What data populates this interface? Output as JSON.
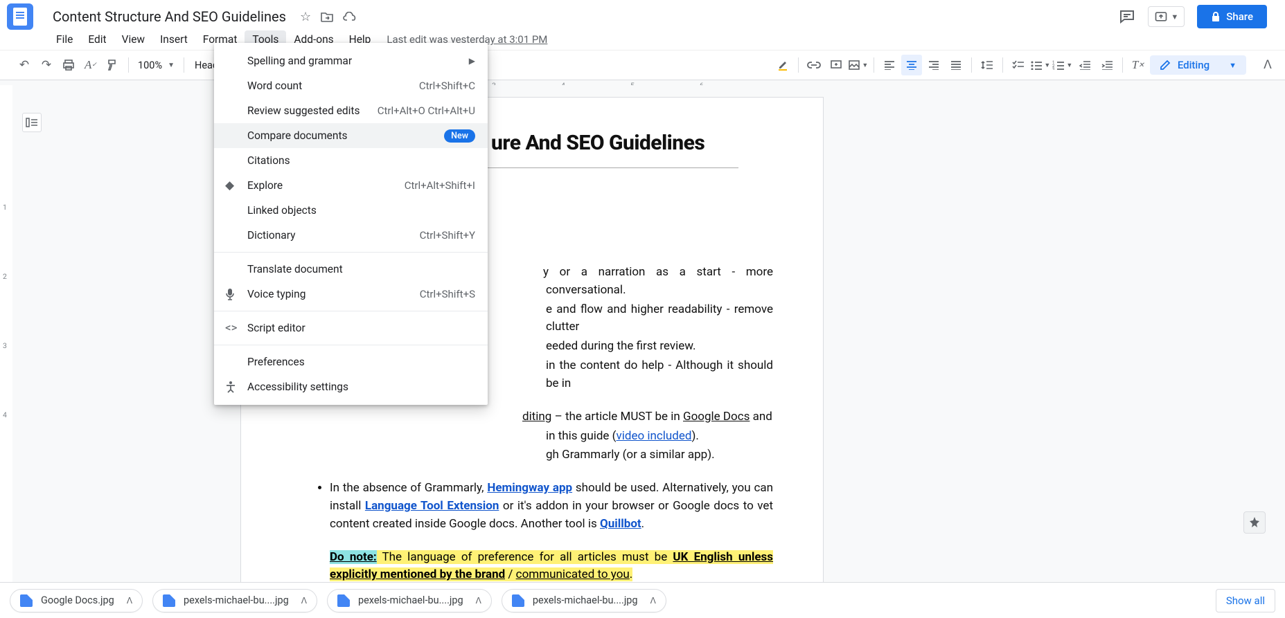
{
  "doc": {
    "title": "Content Structure And SEO Guidelines"
  },
  "menus": {
    "file": "File",
    "edit": "Edit",
    "view": "View",
    "insert": "Insert",
    "format": "Format",
    "tools": "Tools",
    "addons": "Add-ons",
    "help": "Help"
  },
  "last_edit": "Last edit was yesterday at 3:01 PM",
  "share": {
    "label": "Share"
  },
  "toolbar": {
    "zoom": "100%",
    "style": "Headin",
    "editing": "Editing"
  },
  "dropdown": {
    "spelling": "Spelling and grammar",
    "wordcount": {
      "label": "Word count",
      "shortcut": "Ctrl+Shift+C"
    },
    "review": {
      "label": "Review suggested edits",
      "shortcut": "Ctrl+Alt+O Ctrl+Alt+U"
    },
    "compare": {
      "label": "Compare documents",
      "badge": "New"
    },
    "citations": "Citations",
    "explore": {
      "label": "Explore",
      "shortcut": "Ctrl+Alt+Shift+I"
    },
    "linked": "Linked objects",
    "dictionary": {
      "label": "Dictionary",
      "shortcut": "Ctrl+Shift+Y"
    },
    "translate": "Translate document",
    "voice": {
      "label": "Voice typing",
      "shortcut": "Ctrl+Shift+S"
    },
    "script": "Script editor",
    "prefs": "Preferences",
    "a11y": "Accessibility settings"
  },
  "page_content": {
    "heading_partial": "ure And SEO Guidelines",
    "b1_a": "y or a narration as a start - more conversational.",
    "b2_a": "e and flow and higher readability - remove clutter",
    "b2_b": "eeded during the first review.",
    "b3_a": " in the content do help - Although it should be in",
    "b4_pre": "diting",
    "b4_mid": " – the article MUST be in ",
    "b4_link": "Google Docs",
    "b4_post": " and",
    "b4_line2_a": " in this guide (",
    "b4_link2": "video included",
    "b4_line2_b": ").",
    "b5": "gh Grammarly (or a similar app).",
    "b6_a": "In the absence of Grammarly, ",
    "b6_link1": "Hemingway app",
    "b6_b": " should be used. Alternatively, you can install ",
    "b6_link2": "Language Tool Extension",
    "b6_c": " or it's addon in your browser or Google docs to vet content created inside Google docs. Another tool is ",
    "b6_link3": "Quillbot",
    "note_tag": "Do note:",
    "note_a": " The language of preference for all articles must be ",
    "note_b": "UK English unless explicitly mentioned by the brand",
    "note_c": " / ",
    "note_d": "communicated to you",
    "period": "."
  },
  "ruler": {
    "n3": "3",
    "n4": "4",
    "n5": "5",
    "n6": "6"
  },
  "vruler": {
    "n1": "1",
    "n2": "2",
    "n3": "3",
    "n4": "4"
  },
  "downloads": {
    "f1": "Google Docs.jpg",
    "f2": "pexels-michael-bu....jpg",
    "f3": "pexels-michael-bu....jpg",
    "f4": "pexels-michael-bu....jpg",
    "showall": "Show all"
  }
}
